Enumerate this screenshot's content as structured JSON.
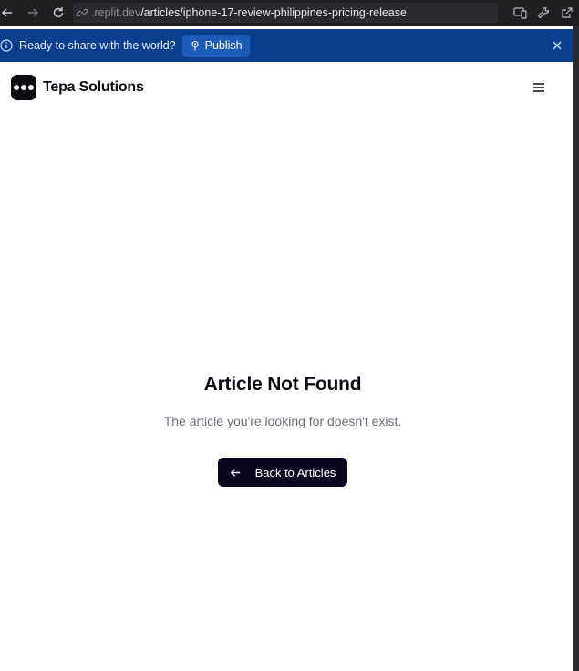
{
  "browser": {
    "url_domain": ".replit.dev",
    "url_path": "/articles/iphone-17-review-philippines-pricing-release"
  },
  "banner": {
    "message": "Ready to share with the world?",
    "publish_label": "Publish"
  },
  "header": {
    "brand": "Tepa Solutions"
  },
  "main": {
    "title": "Article Not Found",
    "subtitle": "The article you're looking for doesn't exist.",
    "back_label": "Back to Articles"
  },
  "colors": {
    "banner_bg": "#0b3f8e",
    "publish_bg": "#1d5bb8",
    "button_bg": "#0b0620",
    "brand_dark": "#0b0b12"
  }
}
